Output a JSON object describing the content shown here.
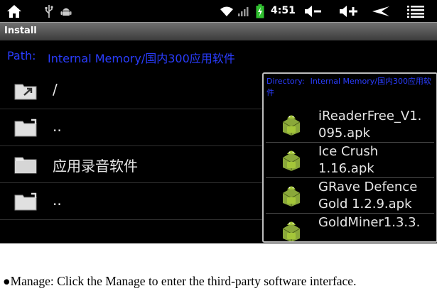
{
  "status_bar": {
    "time": "4:51",
    "icons": [
      "home-icon",
      "usb-icon",
      "android-debug-icon",
      "wifi-icon",
      "signal-icon",
      "battery-icon",
      "volume-down-icon",
      "volume-up-icon",
      "back-icon",
      "menu-icon"
    ]
  },
  "app": {
    "title": "Install"
  },
  "path": {
    "label": "Path:",
    "value": "Internal Memory/国内300应用软件"
  },
  "file_list": [
    {
      "name": "/",
      "icon": "folder-up-icon"
    },
    {
      "name": "..",
      "icon": "folder-up-icon"
    },
    {
      "name": "应用录音软件",
      "icon": "folder-icon"
    },
    {
      "name": "..",
      "icon": "folder-up-icon"
    }
  ],
  "popup": {
    "directory_label": "Directory:",
    "directory_value": "Internal Memory/国内300应用软件",
    "apps": [
      {
        "name": "iReaderFree_V1.\n095.apk",
        "icon": "android-apk-icon"
      },
      {
        "name": "Ice Crush\n1.16.apk",
        "icon": "android-apk-icon"
      },
      {
        "name": "GRave Defence\nGold 1.2.9.apk",
        "icon": "android-apk-icon"
      },
      {
        "name": "GoldMiner1.3.3.",
        "icon": "android-apk-icon"
      }
    ]
  },
  "caption": {
    "text": "●Manage: Click the Manage to enter the third-party software interface."
  },
  "colors": {
    "path_text": "#2a3dff",
    "background": "#000000",
    "titlebar": "#4f4f4f"
  }
}
